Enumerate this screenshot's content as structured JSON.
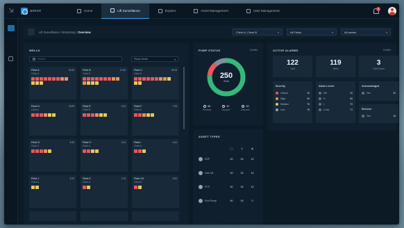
{
  "app": {
    "brand": "aveon"
  },
  "nav": {
    "tabs": [
      {
        "label": "Home",
        "active": false
      },
      {
        "label": "Lift Surveillance",
        "active": true
      },
      {
        "label": "Explore",
        "active": false
      },
      {
        "label": "Asset Management",
        "active": false
      },
      {
        "label": "User Management",
        "active": false
      }
    ],
    "notifications_count": "3"
  },
  "breadcrumb": {
    "path": "Lift Surveillance / Monitoring / ",
    "current": "Overview"
  },
  "filters": [
    {
      "value": "Client A, Client B"
    },
    {
      "value": "All Fields"
    },
    {
      "value": "All assets"
    }
  ],
  "wells_panel": {
    "title": "WELLS",
    "search_placeholder": "Search",
    "sort_value": "Pump Score",
    "colors": {
      "red": "#e8585b",
      "orange": "#e8905a",
      "yellow": "#e8c85a"
    },
    "wells": [
      {
        "name": "Field A",
        "client": "Client A",
        "time": "03:16",
        "dots": [
          "red",
          "red",
          "red",
          "red",
          "red",
          "red",
          "red",
          "orange",
          "orange",
          "yellow",
          "yellow",
          "yellow"
        ]
      },
      {
        "name": "Field B",
        "client": "Client B",
        "time": "17:40",
        "dots": [
          "red",
          "red",
          "red",
          "red",
          "red",
          "red",
          "red",
          "orange",
          "orange",
          "orange",
          "yellow",
          "yellow",
          "yellow"
        ]
      },
      {
        "name": "Field C",
        "client": "Client A",
        "time": "05:15",
        "dots": [
          "red",
          "red",
          "red",
          "red",
          "red",
          "red",
          "orange",
          "orange",
          "yellow",
          "yellow",
          "yellow"
        ]
      },
      {
        "name": "Field D",
        "client": "Client A",
        "time": "10:05",
        "dots": [
          "red",
          "red",
          "red",
          "orange",
          "yellow",
          "yellow"
        ]
      },
      {
        "name": "Field E",
        "client": "Client B",
        "time": "6:11",
        "dots": [
          "red",
          "red",
          "red",
          "orange",
          "yellow",
          "yellow"
        ]
      },
      {
        "name": "Field F",
        "client": "Client A",
        "time": "7:03",
        "dots": [
          "red",
          "red",
          "orange",
          "yellow",
          "yellow"
        ]
      },
      {
        "name": "Field G",
        "client": "Client A",
        "time": "6:10",
        "dots": [
          "red",
          "red",
          "red",
          "orange",
          "yellow"
        ]
      },
      {
        "name": "Field H",
        "client": "Client A",
        "time": "6:11",
        "dots": [
          "red",
          "red",
          "yellow",
          "yellow"
        ]
      },
      {
        "name": "Field I",
        "client": "Client A",
        "time": "6:11",
        "dots": [
          "red",
          "red",
          "yellow"
        ]
      },
      {
        "name": "Field J",
        "client": "Client A",
        "time": "5:13",
        "dots": [
          "yellow",
          "yellow"
        ]
      },
      {
        "name": "Field K",
        "client": "Client A",
        "time": "1:13",
        "dots": [
          "red",
          "yellow"
        ]
      },
      {
        "name": "Field XX",
        "client": "Client B",
        "time": "6:11",
        "dots": [
          "red",
          "yellow"
        ]
      }
    ]
  },
  "pump_status": {
    "title": "PUMP STATUS",
    "link": "Details",
    "total": "250",
    "total_label": "Wells",
    "segments": [
      {
        "name": "Running",
        "value": 190,
        "color": "#35b97a"
      },
      {
        "name": "Stopped",
        "value": 32,
        "color": "#e8585b"
      },
      {
        "name": "Unknown",
        "value": 28,
        "color": "#7d8fa0"
      }
    ],
    "legend": [
      {
        "value": "98",
        "label": "Running"
      },
      {
        "value": "32",
        "label": "Stopped"
      },
      {
        "value": "28",
        "label": "Unknown"
      }
    ]
  },
  "asset_types": {
    "title": "ASSET TYPES",
    "rows": [
      {
        "name": "ESP",
        "values": [
          "40",
          "15",
          "12"
        ]
      },
      {
        "name": "Gas Lift",
        "values": [
          "40",
          "15",
          "12"
        ]
      },
      {
        "name": "PCP",
        "values": [
          "40",
          "15",
          "12"
        ]
      },
      {
        "name": "Rod Pump",
        "values": [
          "40",
          "15",
          "0"
        ]
      }
    ]
  },
  "active_alarms": {
    "title": "ACTIVE ALARMS",
    "link": "Details",
    "stats": [
      {
        "value": "122",
        "label": "Total"
      },
      {
        "value": "119",
        "label": "Wells"
      },
      {
        "value": "3",
        "label": "LAN Events"
      }
    ],
    "severity": {
      "title": "Severity",
      "rows": [
        {
          "label": "Critical",
          "value": "10",
          "color": "#e8585b"
        },
        {
          "label": "High",
          "value": "30",
          "color": "#e8905a"
        },
        {
          "label": "Medium",
          "value": "76",
          "color": "#e8c85a"
        },
        {
          "label": "Low",
          "value": "76",
          "color": "#8fa6b8"
        }
      ]
    },
    "alarm_levels": {
      "title": "Alarm Levels",
      "rows": [
        {
          "label": "HH",
          "value": "10"
        },
        {
          "label": "H",
          "value": "60"
        },
        {
          "label": "L",
          "value": "70"
        },
        {
          "label": "LLow",
          "value": "71"
        }
      ]
    },
    "acknowledged": {
      "title": "Acknowledged",
      "rows": [
        {
          "label": "Yes",
          "value": "20"
        }
      ]
    },
    "shelved": {
      "title": "Shelved",
      "rows": [
        {
          "label": "Yes",
          "value": "15"
        }
      ]
    }
  }
}
